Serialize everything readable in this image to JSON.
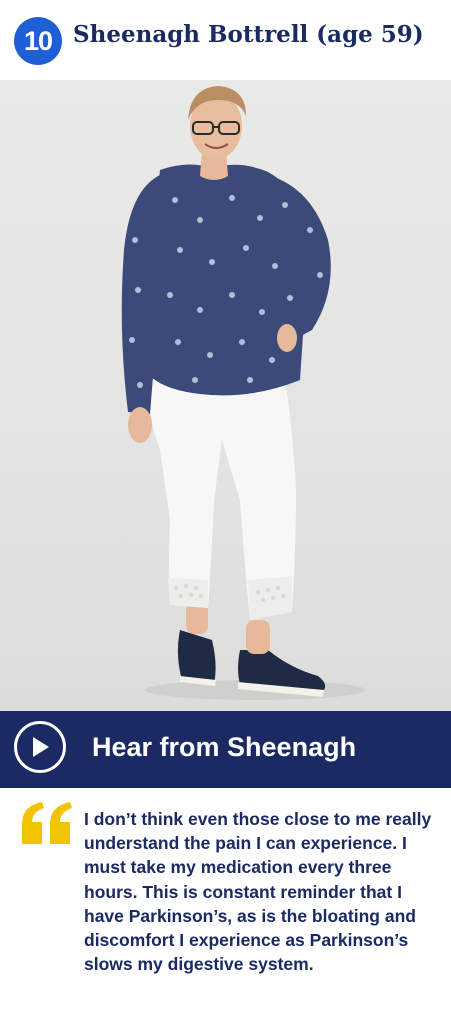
{
  "header": {
    "number": "10",
    "title": "Sheenagh Bottrell (age 59)"
  },
  "photo": {
    "subject": "Sheenagh"
  },
  "audio": {
    "label": "Hear from Sheenagh",
    "icon": "play-icon"
  },
  "quote": {
    "icon": "quote-icon",
    "text": "I don’t think even those close to me really understand the pain I can experience. I must take my medication every three hours. This is constant reminder that I have Parkinson’s, as is the bloating and discomfort I experience as Parkinson’s slows my digestive system."
  },
  "colors": {
    "navy": "#1b2a63",
    "badge_blue": "#1f5fd6",
    "quote_yellow": "#f2c400"
  }
}
